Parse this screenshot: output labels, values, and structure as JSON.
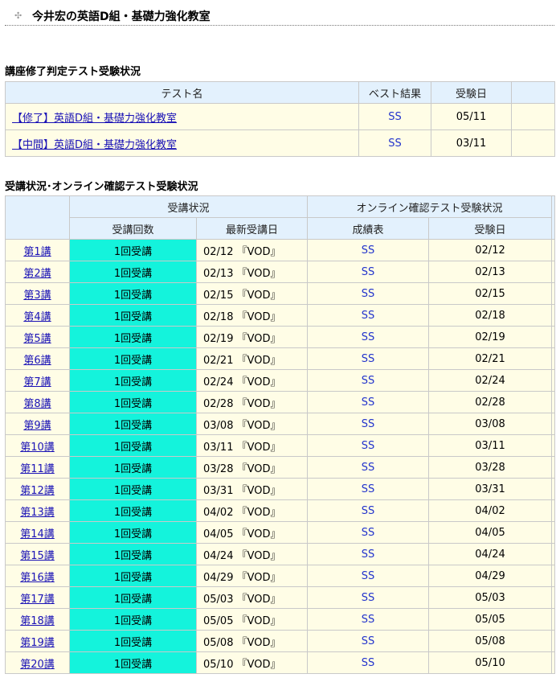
{
  "page_title": "今井宏の英語D組・基礎力強化教室",
  "section1": {
    "heading": "講座修了判定テスト受験状況",
    "headers": [
      "テスト名",
      "ベスト結果",
      "受験日"
    ],
    "rows": [
      {
        "name": "【修了】英語D組・基礎力強化教室",
        "result": "SS",
        "date": "05/11"
      },
      {
        "name": "【中間】英語D組・基礎力強化教室",
        "result": "SS",
        "date": "03/11"
      }
    ]
  },
  "section2": {
    "heading": "受講状況･オンライン確認テスト受験状況",
    "group_headers": [
      "受講状況",
      "オンライン確認テスト受験状況"
    ],
    "sub_headers": [
      "受講回数",
      "最新受講日",
      "成績表",
      "受験日"
    ],
    "rows": [
      {
        "lesson": "第1講",
        "count": "1回受講",
        "latest": "02/12 『VOD』",
        "grade": "SS",
        "date": "02/12"
      },
      {
        "lesson": "第2講",
        "count": "1回受講",
        "latest": "02/13 『VOD』",
        "grade": "SS",
        "date": "02/13"
      },
      {
        "lesson": "第3講",
        "count": "1回受講",
        "latest": "02/15 『VOD』",
        "grade": "SS",
        "date": "02/15"
      },
      {
        "lesson": "第4講",
        "count": "1回受講",
        "latest": "02/18 『VOD』",
        "grade": "SS",
        "date": "02/18"
      },
      {
        "lesson": "第5講",
        "count": "1回受講",
        "latest": "02/19 『VOD』",
        "grade": "SS",
        "date": "02/19"
      },
      {
        "lesson": "第6講",
        "count": "1回受講",
        "latest": "02/21 『VOD』",
        "grade": "SS",
        "date": "02/21"
      },
      {
        "lesson": "第7講",
        "count": "1回受講",
        "latest": "02/24 『VOD』",
        "grade": "SS",
        "date": "02/24"
      },
      {
        "lesson": "第8講",
        "count": "1回受講",
        "latest": "02/28 『VOD』",
        "grade": "SS",
        "date": "02/28"
      },
      {
        "lesson": "第9講",
        "count": "1回受講",
        "latest": "03/08 『VOD』",
        "grade": "SS",
        "date": "03/08"
      },
      {
        "lesson": "第10講",
        "count": "1回受講",
        "latest": "03/11 『VOD』",
        "grade": "SS",
        "date": "03/11"
      },
      {
        "lesson": "第11講",
        "count": "1回受講",
        "latest": "03/28 『VOD』",
        "grade": "SS",
        "date": "03/28"
      },
      {
        "lesson": "第12講",
        "count": "1回受講",
        "latest": "03/31 『VOD』",
        "grade": "SS",
        "date": "03/31"
      },
      {
        "lesson": "第13講",
        "count": "1回受講",
        "latest": "04/02 『VOD』",
        "grade": "SS",
        "date": "04/02"
      },
      {
        "lesson": "第14講",
        "count": "1回受講",
        "latest": "04/05 『VOD』",
        "grade": "SS",
        "date": "04/05"
      },
      {
        "lesson": "第15講",
        "count": "1回受講",
        "latest": "04/24 『VOD』",
        "grade": "SS",
        "date": "04/24"
      },
      {
        "lesson": "第16講",
        "count": "1回受講",
        "latest": "04/29 『VOD』",
        "grade": "SS",
        "date": "04/29"
      },
      {
        "lesson": "第17講",
        "count": "1回受講",
        "latest": "05/03 『VOD』",
        "grade": "SS",
        "date": "05/03"
      },
      {
        "lesson": "第18講",
        "count": "1回受講",
        "latest": "05/05 『VOD』",
        "grade": "SS",
        "date": "05/05"
      },
      {
        "lesson": "第19講",
        "count": "1回受講",
        "latest": "05/08 『VOD』",
        "grade": "SS",
        "date": "05/08"
      },
      {
        "lesson": "第20講",
        "count": "1回受講",
        "latest": "05/10 『VOD』",
        "grade": "SS",
        "date": "05/10"
      }
    ]
  }
}
